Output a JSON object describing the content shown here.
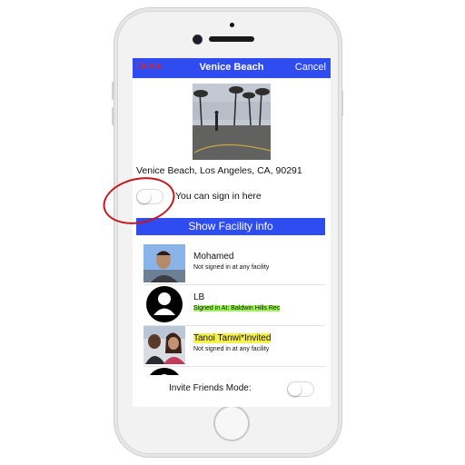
{
  "navbar": {
    "left_label": "Delete",
    "title": "Venice Beach",
    "right_label": "Cancel"
  },
  "facility": {
    "address": "Venice Beach, Los Angeles, CA, 90291",
    "sign_in_label": "You can sign in here",
    "show_info_label": "Show Facility info",
    "sign_in_toggle_on": false
  },
  "friends": [
    {
      "name": "Mohamed",
      "status": "Not signed in at any facility"
    },
    {
      "name": "LB",
      "status": "Signed in At: Baldwin Hills Rec"
    },
    {
      "name": "Tanoi Tanwi*Invited",
      "status": "Not signed in at any facility"
    }
  ],
  "invite": {
    "label": "Invite Friends Mode:",
    "toggle_on": false
  },
  "colors": {
    "nav_blue": "#2f4cf0",
    "delete_red": "#e0261f",
    "highlight_yellow": "#f6f14a",
    "highlight_green": "#9ef25a",
    "annotation_red": "#c4181f"
  }
}
